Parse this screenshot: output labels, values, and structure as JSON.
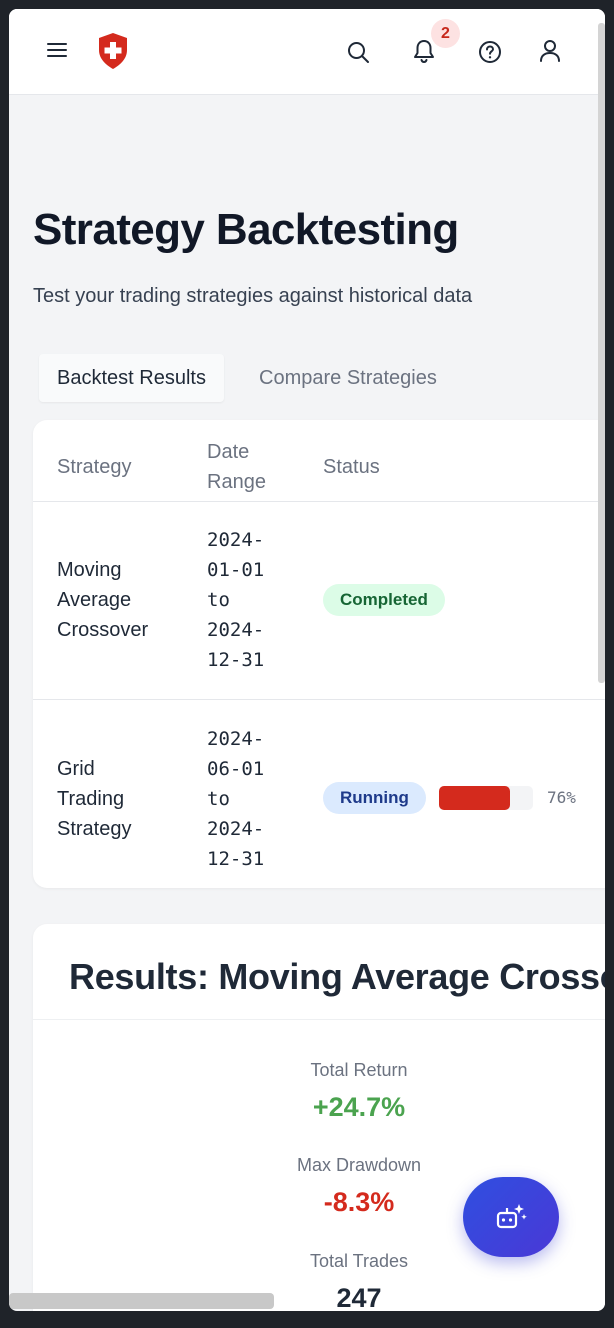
{
  "header": {
    "menu_icon": "hamburger-menu-icon",
    "logo_icon": "red-shield-cross-logo",
    "search_icon": "search-icon",
    "bell_icon": "bell-icon",
    "notification_count": "2",
    "help_icon": "help-circle-icon",
    "user_icon": "user-icon"
  },
  "page": {
    "title": "Strategy Backtesting",
    "subtitle": "Test your trading strategies against historical data"
  },
  "tabs": [
    {
      "label": "Backtest Results",
      "active": true
    },
    {
      "label": "Compare Strategies",
      "active": false
    }
  ],
  "table": {
    "headers": {
      "strategy": "Strategy",
      "date_range": "Date Range",
      "status": "Status"
    },
    "rows": [
      {
        "strategy": "Moving Average Crossover",
        "date_range": "2024-01-01 to 2024-12-31",
        "status": "Completed"
      },
      {
        "strategy": "Grid Trading Strategy",
        "date_range": "2024-06-01 to 2024-12-31",
        "status": "Running",
        "progress": 76,
        "progress_text": "76%"
      }
    ]
  },
  "results": {
    "title": "Results: Moving Average Crossover",
    "metrics": [
      {
        "label": "Total Return",
        "value": "+24.7%"
      },
      {
        "label": "Max Drawdown",
        "value": "-8.3%"
      },
      {
        "label": "Total Trades",
        "value": "247"
      }
    ]
  },
  "fab": {
    "icon": "ai-robot-sparkle-icon"
  },
  "colors": {
    "brand_red": "#d42a1d",
    "positive": "#4ba34f",
    "negative": "#d42a1d",
    "fab_blue": "#3b45dc",
    "completed_bg": "#dcfce7",
    "running_bg": "#dbeafe"
  }
}
